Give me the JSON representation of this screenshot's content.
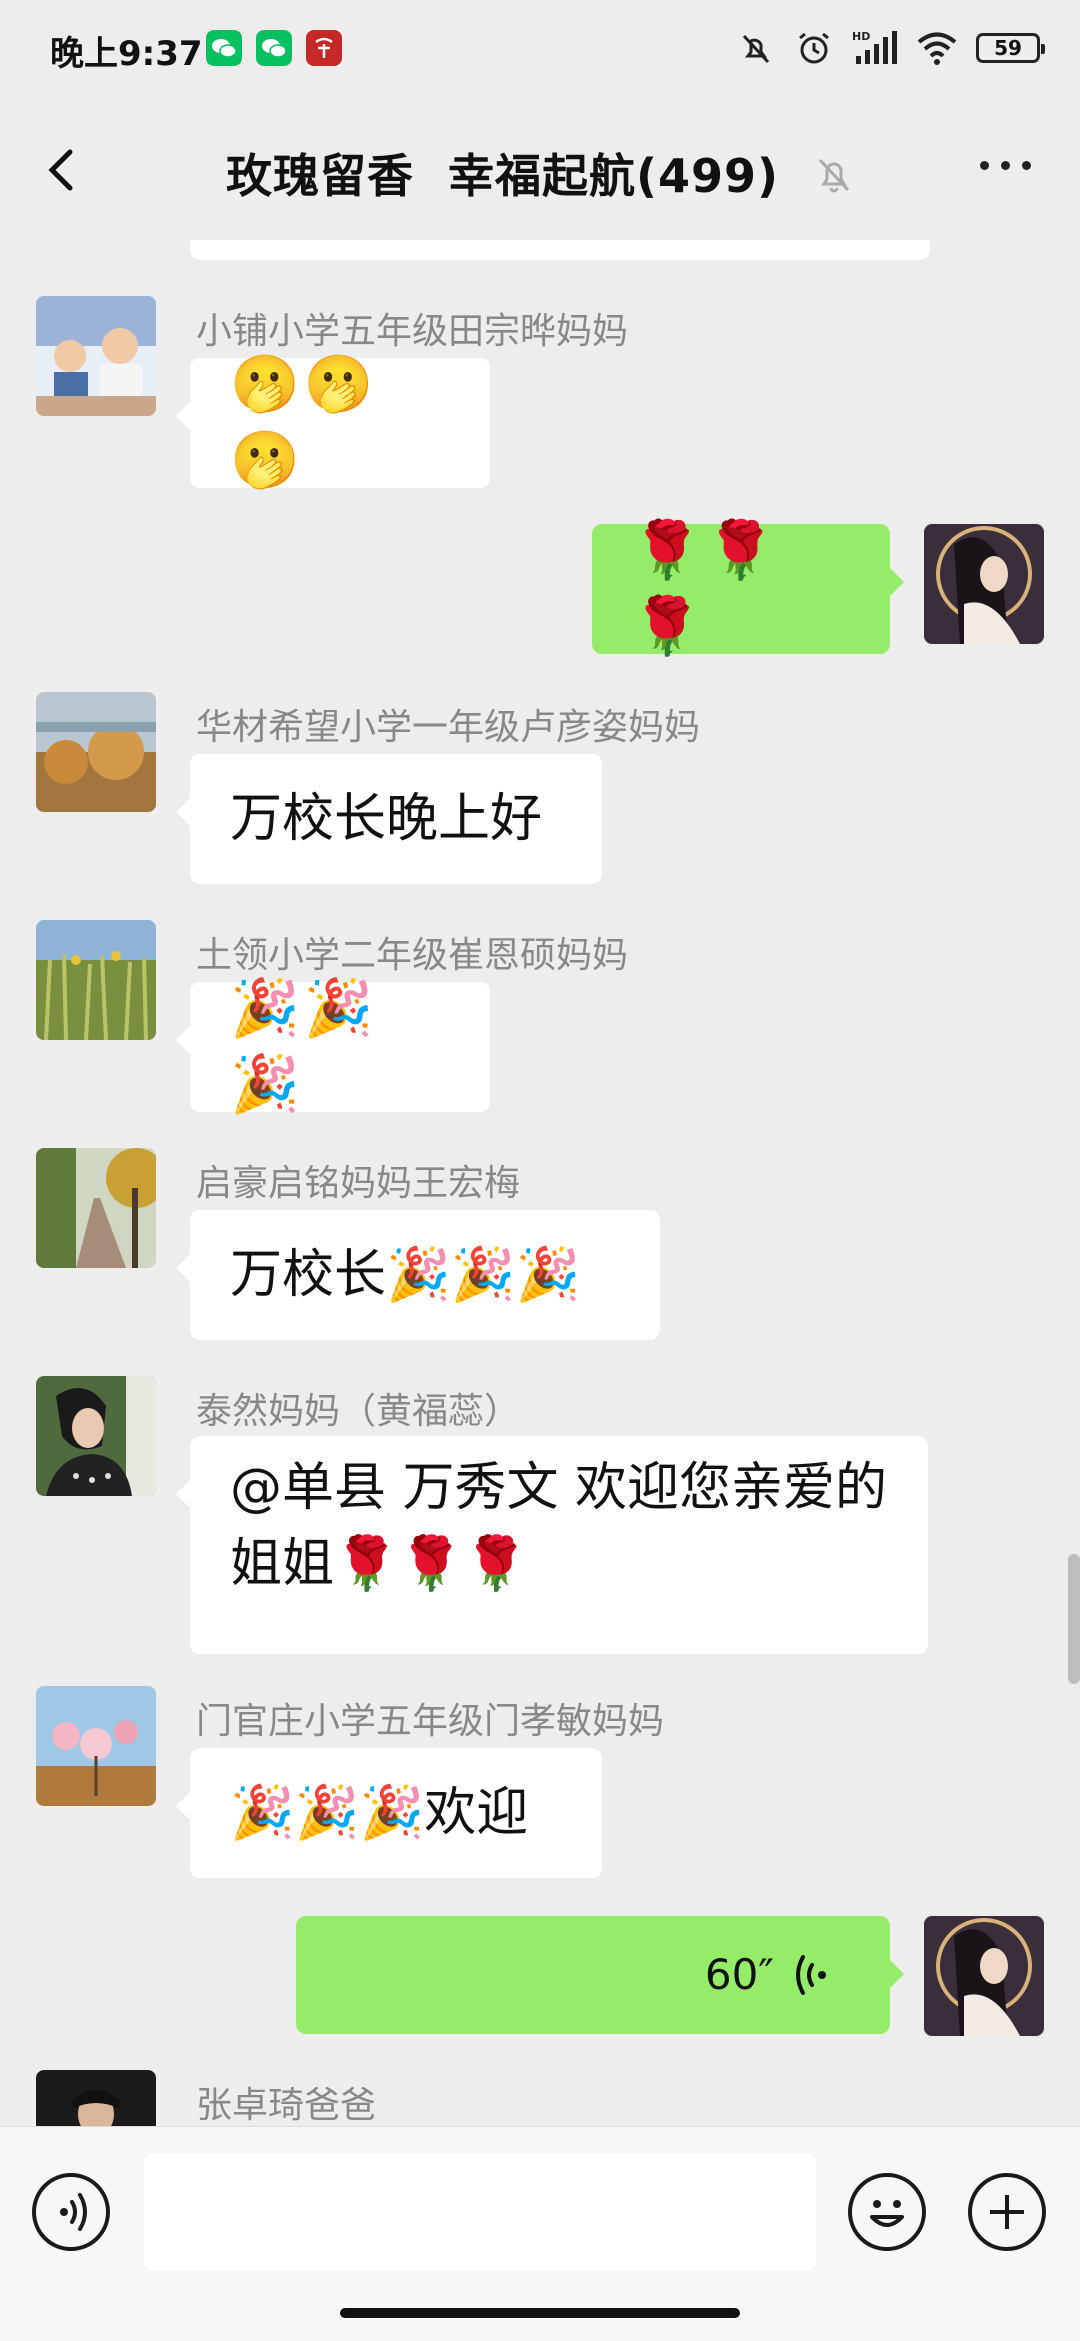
{
  "status_bar": {
    "time": "晚上9:37",
    "battery": "59",
    "icons": [
      "wechat-icon",
      "wechat-icon",
      "app-red-icon",
      "mute-icon",
      "alarm-icon",
      "signal-hd-icon",
      "wifi-icon",
      "battery-icon"
    ]
  },
  "header": {
    "title": "玫瑰留香  幸福起航(499)",
    "back_icon": "chevron-left-icon",
    "muted_icon": "bell-off-icon",
    "more_icon": "more-dots-icon"
  },
  "messages": [
    {
      "sender": "小铺小学五年级田宗晔妈妈",
      "text": "🫢🫢🫢",
      "mine": false
    },
    {
      "sender": "",
      "text": "🌹🌹🌹",
      "mine": true
    },
    {
      "sender": "华材希望小学一年级卢彦姿妈妈",
      "text": "万校长晚上好",
      "mine": false
    },
    {
      "sender": "土领小学二年级崔恩硕妈妈",
      "text": "🎉🎉🎉",
      "mine": false
    },
    {
      "sender": "启豪启铭妈妈王宏梅",
      "text": "万校长🎉🎉🎉",
      "mine": false
    },
    {
      "sender": "泰然妈妈（黄福蕊）",
      "text": "@单县 万秀文  欢迎您亲爱的姐姐🌹🌹🌹",
      "mine": false
    },
    {
      "sender": "门官庄小学五年级门孝敏妈妈",
      "text": "🎉🎉🎉欢迎",
      "mine": false
    },
    {
      "sender": "",
      "text": "60″",
      "type": "voice",
      "mine": true
    },
    {
      "sender": "张卓琦爸爸",
      "text": "",
      "mine": false
    }
  ],
  "input_bar": {
    "voice_icon": "voice-toggle-icon",
    "emoji_icon": "emoji-smile-icon",
    "plus_icon": "plus-icon",
    "placeholder": ""
  },
  "colors": {
    "background": "#ededed",
    "my_bubble": "#95ec69",
    "other_bubble": "#ffffff",
    "sender_name": "#888888",
    "wechat_green": "#07c160"
  }
}
